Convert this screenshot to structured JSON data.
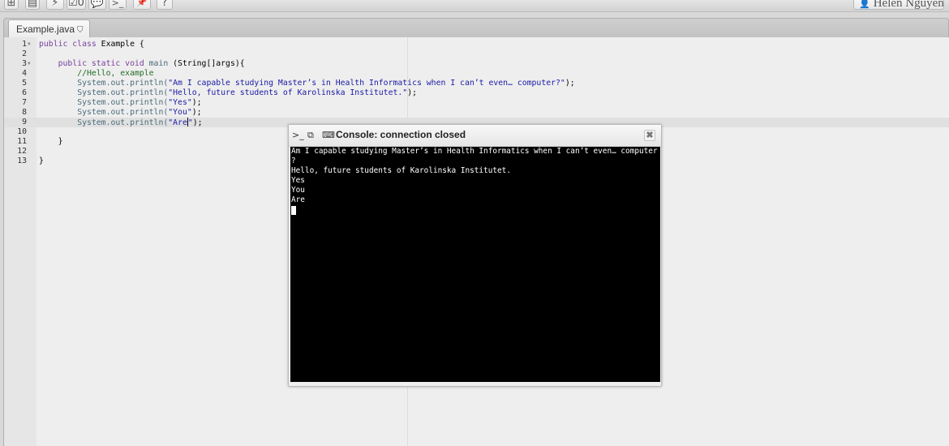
{
  "toolbar": {
    "buttons": [
      {
        "name": "add-file-icon",
        "glyph": "⊞"
      },
      {
        "name": "save-icon",
        "glyph": "▤"
      },
      {
        "name": "run-icon",
        "glyph": "⚡"
      },
      {
        "name": "checklist-icon",
        "glyph": "☑0"
      },
      {
        "name": "comment-icon",
        "glyph": "💬"
      },
      {
        "name": "terminal-icon",
        "glyph": ">_"
      },
      {
        "name": "pin-icon",
        "glyph": "📌"
      },
      {
        "name": "help-icon",
        "glyph": "?"
      }
    ],
    "user_name": "Helen Nguyen"
  },
  "tab": {
    "label": "Example.java",
    "status_icon": "shield-icon"
  },
  "editor": {
    "lines": [
      {
        "n": "1",
        "fold": true
      },
      {
        "n": "2"
      },
      {
        "n": "3",
        "fold": true
      },
      {
        "n": "4"
      },
      {
        "n": "5"
      },
      {
        "n": "6"
      },
      {
        "n": "7"
      },
      {
        "n": "8"
      },
      {
        "n": "9",
        "active": true
      },
      {
        "n": "10"
      },
      {
        "n": "11"
      },
      {
        "n": "12"
      },
      {
        "n": "13"
      }
    ],
    "code": {
      "l1_kw": "public class",
      "l1_rest": " Example {",
      "l3_kw": "public static void",
      "l3_fn": " main",
      "l3_rest": " (String[]args){",
      "l4_comment": "//Hello, example",
      "println_prefix": "System.out.println(",
      "l5_str": "\"Am I capable studying Master’s in Health Informatics when I can’t even… computer?\"",
      "l6_str": "\"Hello, future students of Karolinska Institutet.\"",
      "l7_str": "\"Yes\"",
      "l8_str": "\"You\"",
      "l9_str_a": "\"Are",
      "l9_str_b": "\"",
      "stmt_end": ");",
      "l11": "}",
      "l13": "}"
    }
  },
  "console": {
    "title": "Console: connection closed",
    "icons": [
      "terminal-icon",
      "copy-icon",
      "keyboard-icon"
    ],
    "close_glyph": "✖",
    "output": [
      "Am I capable studying Master’s in Health Informatics when I can’t even… computer",
      "?",
      "Hello, future students of Karolinska Institutet.",
      "Yes",
      "You",
      "Are"
    ]
  },
  "colors": {
    "keyword": "#7a3e9d",
    "string": "#1a1aa6",
    "comment": "#236e25",
    "terminal_bg": "#000000"
  }
}
